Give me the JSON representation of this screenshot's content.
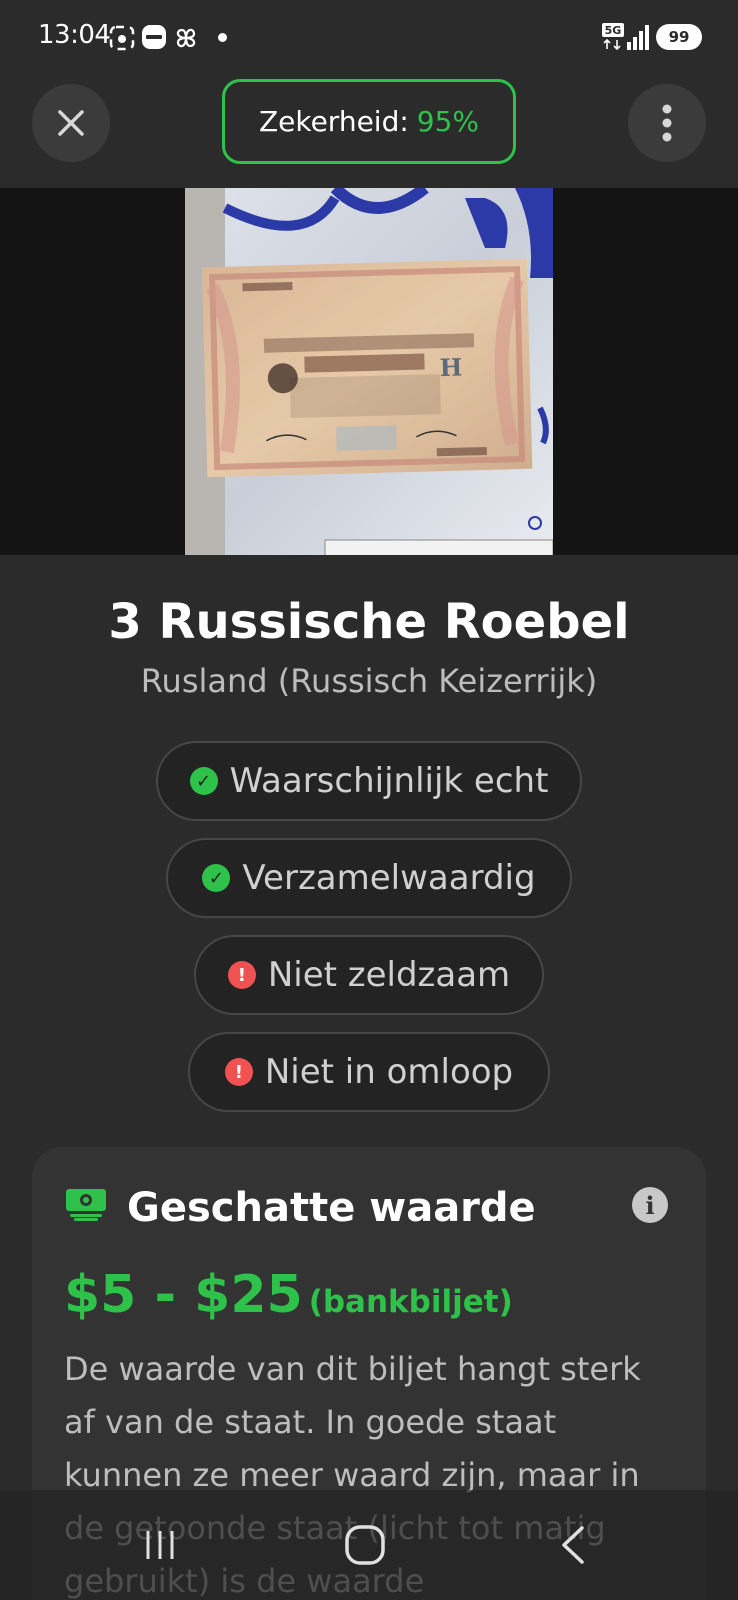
{
  "status_bar": {
    "time": "13:04",
    "network": "5G",
    "battery": "99",
    "icons": [
      "screenshot-icon",
      "news-icon",
      "pinwheel-icon",
      "notification-dot-icon",
      "signal-icon"
    ]
  },
  "header": {
    "confidence_label": "Zekerheid:",
    "confidence_value": "95%",
    "close_icon": "close-icon",
    "more_icon": "more-vertical-icon"
  },
  "item": {
    "title": "3 Russische Roebel",
    "subtitle": "Rusland (Russisch Keizerrijk)"
  },
  "chips": [
    {
      "label": "Waarschijnlijk echt",
      "status": "positive",
      "icon": "check-circle-icon"
    },
    {
      "label": "Verzamelwaardig",
      "status": "positive",
      "icon": "check-circle-icon"
    },
    {
      "label": "Niet zeldzaam",
      "status": "negative",
      "icon": "alert-circle-icon"
    },
    {
      "label": "Niet in omloop",
      "status": "negative",
      "icon": "alert-circle-icon"
    }
  ],
  "value_card": {
    "title": "Geschatte waarde",
    "price_range": "$5 - $25",
    "price_unit": "(bankbiljet)",
    "description": "De waarde van dit biljet hangt sterk af van de staat. In goede staat kunnen ze meer waard zijn, maar in de getoonde staat (licht tot matig gebruikt) is de waarde"
  },
  "colors": {
    "accent_green": "#2ec24a",
    "warning_red": "#f05252",
    "background": "#2b2b2b",
    "card": "#333333"
  },
  "navbar": {
    "icons": [
      "recent-apps-icon",
      "home-icon",
      "back-icon"
    ]
  }
}
